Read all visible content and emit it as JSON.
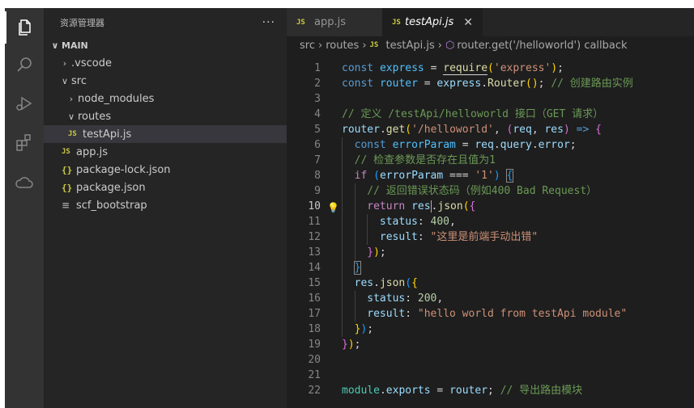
{
  "sidebar": {
    "title": "资源管理器",
    "more": "···",
    "tree": [
      {
        "label": "MAIN",
        "chevron": "∨",
        "kind": "section"
      },
      {
        "label": ".vscode",
        "chevron": "›",
        "kind": "folder"
      },
      {
        "label": "src",
        "chevron": "∨",
        "kind": "folder"
      },
      {
        "label": "node_modules",
        "chevron": "›",
        "kind": "folder"
      },
      {
        "label": "routes",
        "chevron": "∨",
        "kind": "folder"
      },
      {
        "label": "testApi.js",
        "icon": "JS",
        "kind": "file",
        "selected": true
      },
      {
        "label": "app.js",
        "icon": "JS",
        "kind": "file"
      },
      {
        "label": "package-lock.json",
        "icon": "{}",
        "kind": "file"
      },
      {
        "label": "package.json",
        "icon": "{}",
        "kind": "file"
      },
      {
        "label": "scf_bootstrap",
        "icon": "≡",
        "kind": "file"
      }
    ]
  },
  "activity_bar": {
    "icons": [
      "files-icon",
      "search-icon",
      "run-debug-icon",
      "extensions-icon",
      "cloud-icon"
    ]
  },
  "tabs": [
    {
      "label": "app.js",
      "icon": "JS",
      "active": false
    },
    {
      "label": "testApi.js",
      "icon": "JS",
      "active": true,
      "close": "✕"
    }
  ],
  "breadcrumbs": {
    "parts": [
      "src",
      "routes",
      "testApi.js",
      "router.get('/helloworld') callback"
    ],
    "icon_js": "JS",
    "icon_symbol": "⬡"
  },
  "editor": {
    "current_line": 10,
    "lines": [
      {
        "n": "1",
        "indent": 0,
        "tokens": [
          [
            "const",
            "kw"
          ],
          [
            " ",
            ""
          ],
          [
            "express",
            "const"
          ],
          [
            " = ",
            "punc"
          ],
          [
            "require",
            "fn|underline"
          ],
          [
            "(",
            "br1"
          ],
          [
            "'express'",
            "str"
          ],
          [
            ")",
            "br1"
          ],
          [
            ";",
            "punc"
          ]
        ]
      },
      {
        "n": "2",
        "indent": 0,
        "tokens": [
          [
            "const",
            "kw"
          ],
          [
            " ",
            ""
          ],
          [
            "router",
            "const"
          ],
          [
            " = ",
            "punc"
          ],
          [
            "express",
            "var"
          ],
          [
            ".",
            "punc"
          ],
          [
            "Router",
            "fn"
          ],
          [
            "()",
            "br1"
          ],
          [
            "; ",
            "punc"
          ],
          [
            "// 创建路由实例",
            "cmt"
          ]
        ]
      },
      {
        "n": "3",
        "indent": 0,
        "tokens": []
      },
      {
        "n": "4",
        "indent": 0,
        "tokens": [
          [
            "// 定义 /testApi/helloworld 接口（GET 请求）",
            "cmt"
          ]
        ]
      },
      {
        "n": "5",
        "indent": 0,
        "tokens": [
          [
            "router",
            "var"
          ],
          [
            ".",
            "punc"
          ],
          [
            "get",
            "fn"
          ],
          [
            "(",
            "br1"
          ],
          [
            "'/helloworld'",
            "str"
          ],
          [
            ", ",
            "punc"
          ],
          [
            "(",
            "br2"
          ],
          [
            "req",
            "var"
          ],
          [
            ", ",
            "punc"
          ],
          [
            "res",
            "var"
          ],
          [
            ")",
            "br2"
          ],
          [
            " ",
            "punc"
          ],
          [
            "=>",
            "kw"
          ],
          [
            " ",
            "punc"
          ],
          [
            "{",
            "br2"
          ]
        ]
      },
      {
        "n": "6",
        "indent": 1,
        "tokens": [
          [
            "const",
            "kw"
          ],
          [
            " ",
            ""
          ],
          [
            "errorParam",
            "const"
          ],
          [
            " = ",
            "punc"
          ],
          [
            "req",
            "var"
          ],
          [
            ".",
            "punc"
          ],
          [
            "query",
            "var"
          ],
          [
            ".",
            "punc"
          ],
          [
            "error",
            "var"
          ],
          [
            ";",
            "punc"
          ]
        ]
      },
      {
        "n": "7",
        "indent": 1,
        "tokens": [
          [
            "// 检查参数是否存在且值为1",
            "cmt"
          ]
        ]
      },
      {
        "n": "8",
        "indent": 1,
        "tokens": [
          [
            "if",
            "ctl"
          ],
          [
            " ",
            "punc"
          ],
          [
            "(",
            "br3"
          ],
          [
            "errorParam",
            "var"
          ],
          [
            " === ",
            "punc"
          ],
          [
            "'1'",
            "str"
          ],
          [
            ")",
            "br3"
          ],
          [
            " ",
            "punc"
          ],
          [
            "{",
            "br3|boxed"
          ]
        ]
      },
      {
        "n": "9",
        "indent": 2,
        "tokens": [
          [
            "// 返回错误状态码（例如400 Bad Request）",
            "cmt"
          ]
        ]
      },
      {
        "n": "10",
        "indent": 2,
        "bulb": true,
        "tokens": [
          [
            "return",
            "ctl"
          ],
          [
            " ",
            "punc"
          ],
          [
            "res",
            "var|cursorafter"
          ],
          [
            ".",
            "punc"
          ],
          [
            "json",
            "fn"
          ],
          [
            "(",
            "br1"
          ],
          [
            "{",
            "br2"
          ]
        ]
      },
      {
        "n": "11",
        "indent": 3,
        "tokens": [
          [
            "status",
            "var"
          ],
          [
            ": ",
            "punc"
          ],
          [
            "400",
            "num"
          ],
          [
            ",",
            "punc"
          ]
        ]
      },
      {
        "n": "12",
        "indent": 3,
        "tokens": [
          [
            "result",
            "var"
          ],
          [
            ": ",
            "punc"
          ],
          [
            "\"这里是前端手动出错\"",
            "str"
          ]
        ]
      },
      {
        "n": "13",
        "indent": 2,
        "tokens": [
          [
            "}",
            "br2"
          ],
          [
            ")",
            "br1"
          ],
          [
            ";",
            "punc"
          ]
        ]
      },
      {
        "n": "14",
        "indent": 1,
        "tokens": [
          [
            "}",
            "br3|boxed"
          ]
        ]
      },
      {
        "n": "15",
        "indent": 1,
        "tokens": [
          [
            "res",
            "var"
          ],
          [
            ".",
            "punc"
          ],
          [
            "json",
            "fn"
          ],
          [
            "(",
            "br3"
          ],
          [
            "{",
            "br1"
          ]
        ]
      },
      {
        "n": "16",
        "indent": 2,
        "tokens": [
          [
            "status",
            "var"
          ],
          [
            ": ",
            "punc"
          ],
          [
            "200",
            "num"
          ],
          [
            ",",
            "punc"
          ]
        ]
      },
      {
        "n": "17",
        "indent": 2,
        "tokens": [
          [
            "result",
            "var"
          ],
          [
            ": ",
            "punc"
          ],
          [
            "\"hello world from testApi module\"",
            "str"
          ]
        ]
      },
      {
        "n": "18",
        "indent": 1,
        "tokens": [
          [
            "}",
            "br1"
          ],
          [
            ")",
            "br3"
          ],
          [
            ";",
            "punc"
          ]
        ]
      },
      {
        "n": "19",
        "indent": 0,
        "tokens": [
          [
            "}",
            "br2"
          ],
          [
            ")",
            "br1"
          ],
          [
            ";",
            "punc"
          ]
        ]
      },
      {
        "n": "20",
        "indent": 0,
        "tokens": []
      },
      {
        "n": "21",
        "indent": 0,
        "tokens": []
      },
      {
        "n": "22",
        "indent": 0,
        "tokens": [
          [
            "module",
            "cls"
          ],
          [
            ".",
            "punc"
          ],
          [
            "exports",
            "var"
          ],
          [
            " = ",
            "punc"
          ],
          [
            "router",
            "var"
          ],
          [
            "; ",
            "punc"
          ],
          [
            "// 导出路由模块",
            "cmt"
          ]
        ]
      }
    ]
  },
  "colors": {
    "editor_bg": "#1e1e1e",
    "sidebar_bg": "#252526",
    "activity_bg": "#333333",
    "comment": "#6a9955",
    "keyword": "#569cd6",
    "string": "#ce9178"
  }
}
